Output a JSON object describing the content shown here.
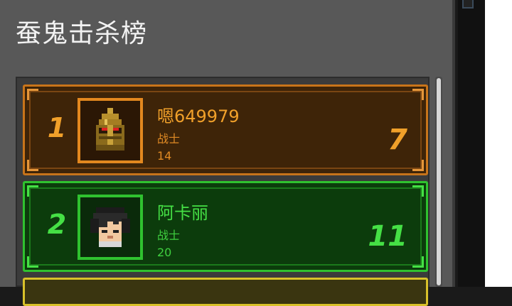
{
  "title": "蚕鬼击杀榜",
  "leaderboard": [
    {
      "rank": "1",
      "name": "嗯649979",
      "class": "战士",
      "level": "14",
      "kills": "7",
      "avatar_icon": "golden-helmet-icon"
    },
    {
      "rank": "2",
      "name": "阿卡丽",
      "class": "战士",
      "level": "20",
      "kills": "11",
      "avatar_icon": "black-hair-character-icon"
    }
  ],
  "colors": {
    "gold_card": "#3e2408",
    "gold_text": "#f0a02a",
    "green_card": "#0c3c0c",
    "green_text": "#45e045",
    "yellow_border": "#d8c12a"
  }
}
